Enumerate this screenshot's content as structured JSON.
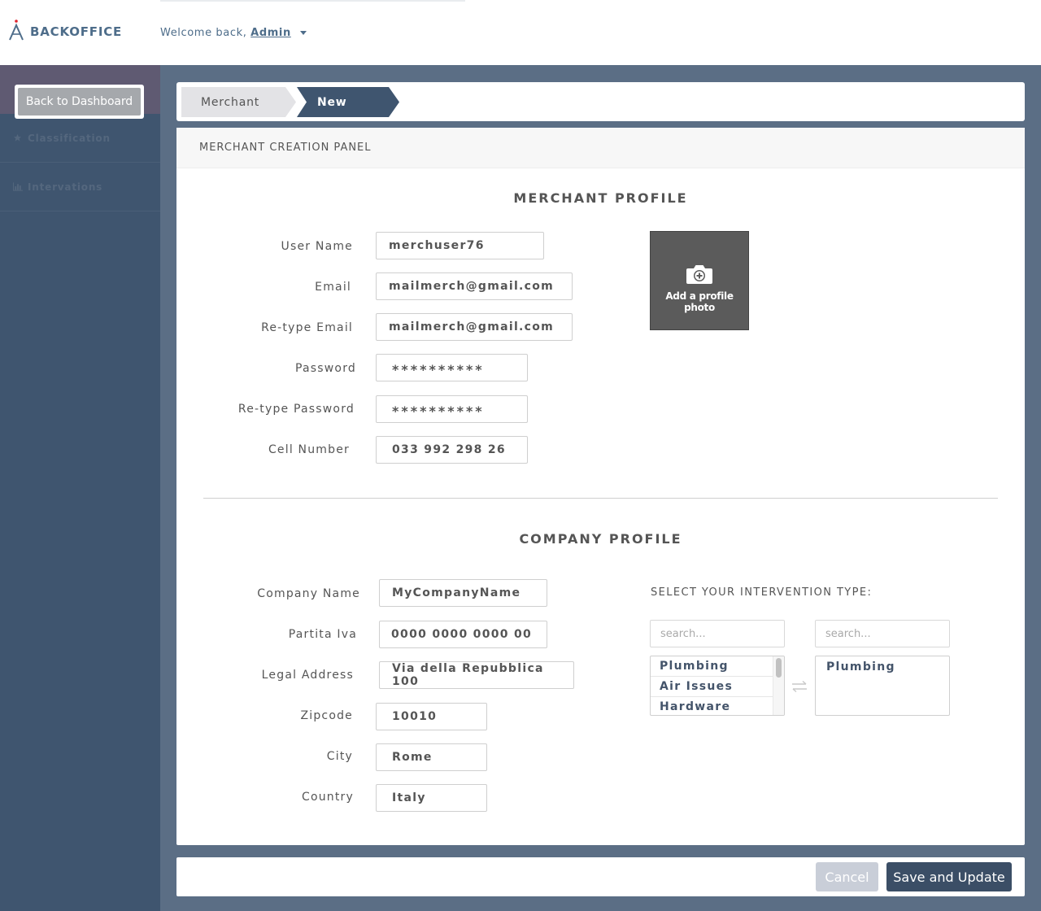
{
  "header": {
    "brand": "BACKOFFICE",
    "welcome_prefix": "Welcome back,",
    "user": "Admin"
  },
  "sidebar": {
    "back_button": "Back to Dashboard",
    "items": [
      {
        "label": "Classification",
        "icon": "star-icon"
      },
      {
        "label": "Intervations",
        "icon": "bar-chart-icon"
      }
    ]
  },
  "breadcrumb": {
    "items": [
      "Merchant",
      "New"
    ]
  },
  "panel": {
    "title": "MERCHANT CREATION PANEL",
    "merchant_profile": {
      "title": "MERCHANT PROFILE",
      "fields": [
        {
          "label": "User Name",
          "value": "merchuser76"
        },
        {
          "label": "Email",
          "value": "mailmerch@gmail.com"
        },
        {
          "label": "Re-type Email",
          "value": "mailmerch@gmail.com"
        },
        {
          "label": "Password",
          "value": "**********"
        },
        {
          "label": "Re-type Password",
          "value": "**********"
        },
        {
          "label": "Cell Number",
          "value": "033 992 298 26"
        }
      ],
      "photo_label": "Add a profile photo"
    },
    "company_profile": {
      "title": "COMPANY PROFILE",
      "fields": [
        {
          "label": "Company Name",
          "value": "MyCompanyName"
        },
        {
          "label": "Partita Iva",
          "value": "0000 0000 0000 00"
        },
        {
          "label": "Legal Address",
          "value": "Via della Repubblica 100"
        },
        {
          "label": "Zipcode",
          "value": "10010"
        },
        {
          "label": "City",
          "value": "Rome"
        },
        {
          "label": "Country",
          "value": "Italy"
        }
      ],
      "intervention": {
        "title": "SELECT YOUR INTERVENTION TYPE:",
        "search_placeholder": "search...",
        "available": [
          "Plumbing",
          "Air Issues",
          "Hardware"
        ],
        "selected": [
          "Plumbing"
        ]
      }
    }
  },
  "footer": {
    "cancel": "Cancel",
    "save": "Save and Update"
  },
  "colors": {
    "brand": "#4e6d8a",
    "sidebar": "#3f556f",
    "primary_button": "#3b4e66",
    "logo_accent": "#e0242e"
  }
}
